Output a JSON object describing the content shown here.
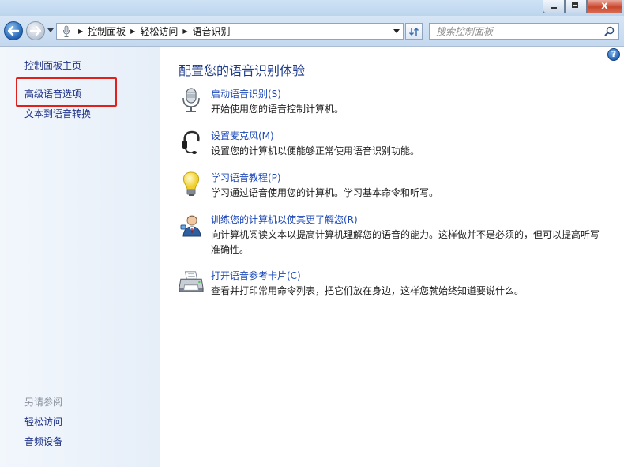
{
  "titlebar": {
    "close_glyph": "x"
  },
  "nav": {
    "back_icon": "back-arrow-icon",
    "forward_icon": "forward-arrow-icon",
    "breadcrumbs": [
      "控制面板",
      "轻松访问",
      "语音识别"
    ],
    "search_placeholder": "搜索控制面板"
  },
  "sidebar": {
    "home": "控制面板主页",
    "links": [
      "高级语音选项",
      "文本到语音转换"
    ],
    "see_also_heading": "另请参阅",
    "see_also": [
      "轻松访问",
      "音频设备"
    ]
  },
  "main": {
    "help_glyph": "?",
    "title": "配置您的语音识别体验",
    "items": [
      {
        "icon": "microphone-icon",
        "label": "启动语音识别(S)",
        "description": "开始使用您的语音控制计算机。"
      },
      {
        "icon": "headset-icon",
        "label": "设置麦克风(M)",
        "description": "设置您的计算机以便能够正常使用语音识别功能。"
      },
      {
        "icon": "lightbulb-icon",
        "label": "学习语音教程(P)",
        "description": "学习通过语音使用您的计算机。学习基本命令和听写。"
      },
      {
        "icon": "user-training-icon",
        "label": "训练您的计算机以使其更了解您(R)",
        "description": "向计算机阅读文本以提高计算机理解您的语音的能力。这样做并不是必须的，但可以提高听写准确性。"
      },
      {
        "icon": "printer-icon",
        "label": "打开语音参考卡片(C)",
        "description": "查看并打印常用命令列表，把它们放在身边，这样您就始终知道要说什么。"
      }
    ]
  },
  "colors": {
    "link": "#1c48b8",
    "title": "#1e3b8c",
    "highlight": "#e0201b"
  }
}
